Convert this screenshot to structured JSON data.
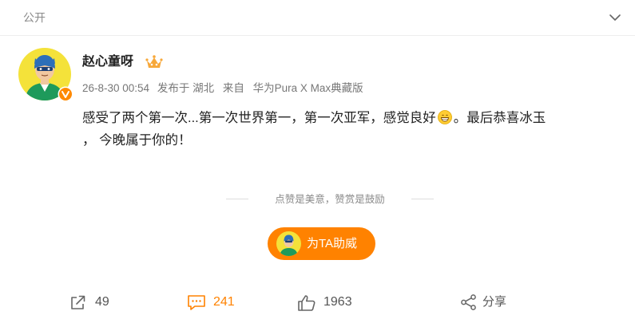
{
  "header": {
    "visibility": "公开"
  },
  "author": {
    "name": "赵心童呀",
    "time": "26-8-30 00:54",
    "location": "发布于 湖北",
    "source": "来自",
    "device": "华为Pura X Max典藏版"
  },
  "post": {
    "line1_before_emoji": "感受了两个第一次...第一次世界第一，第一次亚军，感觉良好",
    "line1_after_emoji": "。最后恭喜冰玉",
    "line2": "，  今晚属于你的！"
  },
  "reward": {
    "divider_text": "点赞是美意，赞赏是鼓励",
    "button_label": "为TA助威"
  },
  "footer": {
    "forward_count": "49",
    "comment_count": "241",
    "like_count": "1963",
    "share_label": "分享"
  },
  "colors": {
    "accent": "#ff8200",
    "muted_text": "#8a8a8a",
    "body_text": "#222222"
  },
  "icons": {
    "visibility": "none",
    "collapse": "chevron-down-icon",
    "badge": "verified-badge-icon",
    "crown": "member-crown-icon",
    "emoji": "grin-emoji",
    "forward": "forward-icon",
    "comment": "comment-icon",
    "like": "like-icon",
    "share": "share-icon"
  }
}
